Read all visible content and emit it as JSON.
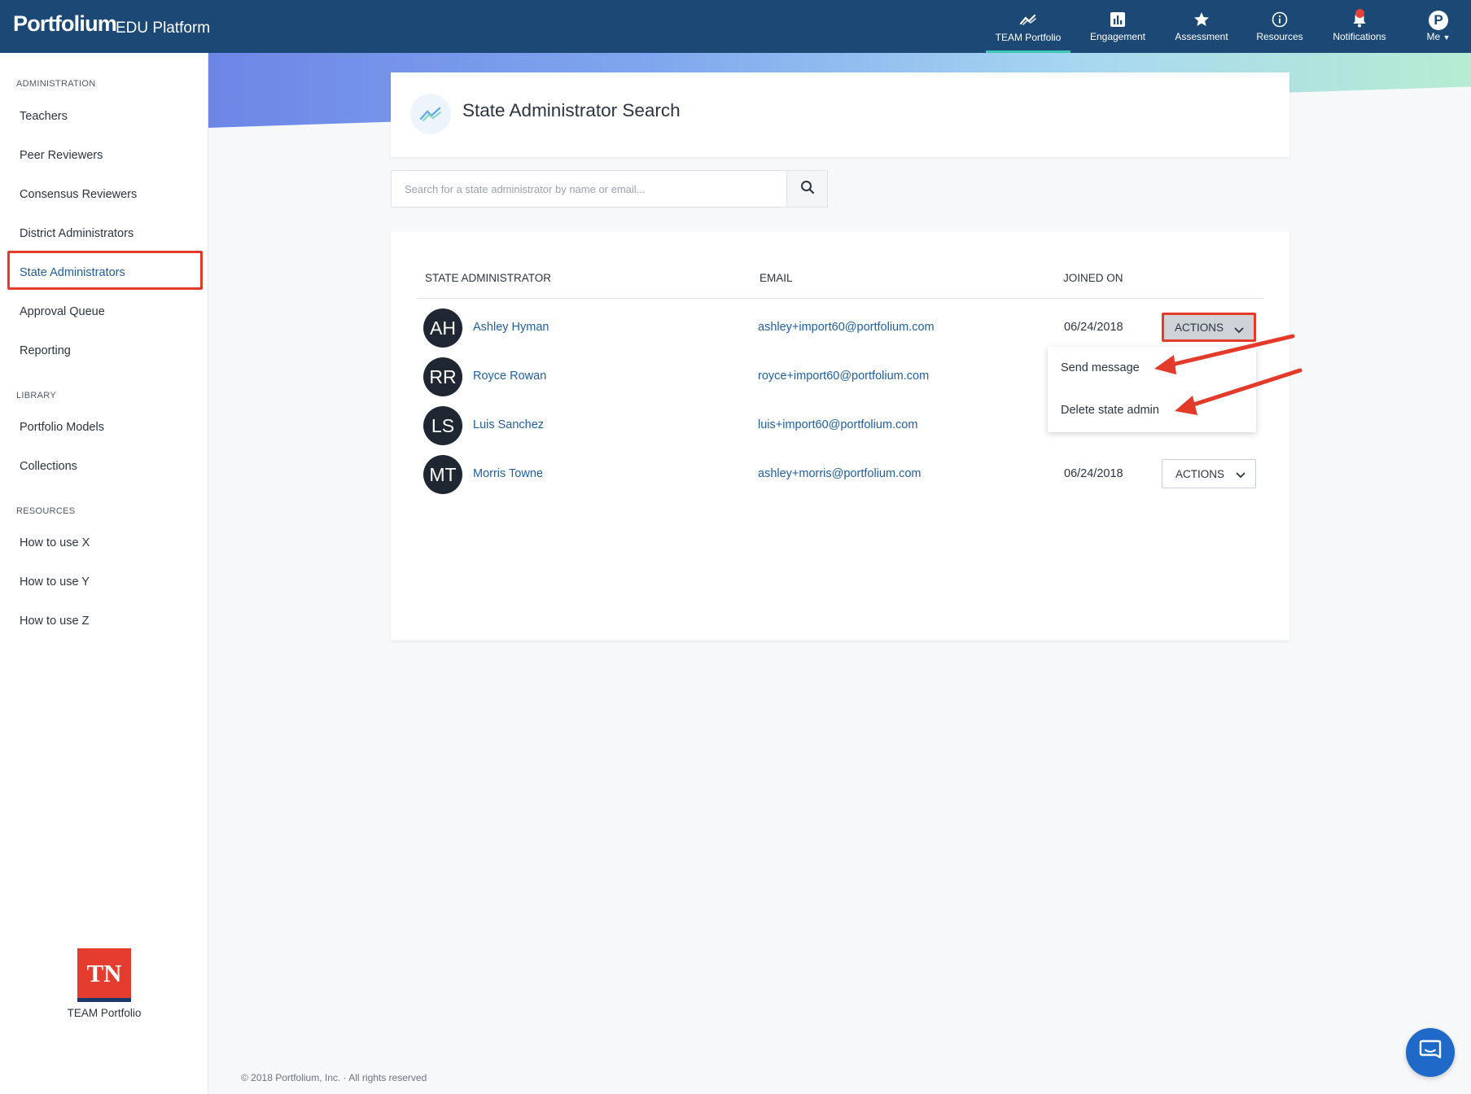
{
  "app": {
    "brand": "Portfolium",
    "subtitle": "EDU Platform"
  },
  "topnav": [
    {
      "label": "TEAM Portfolio",
      "icon": "chart-line-icon",
      "active": true
    },
    {
      "label": "Engagement",
      "icon": "bar-chart-icon"
    },
    {
      "label": "Assessment",
      "icon": "star-icon"
    },
    {
      "label": "Resources",
      "icon": "info-icon"
    },
    {
      "label": "Notifications",
      "icon": "bell-icon"
    },
    {
      "label": "Me",
      "icon": "user-avatar-icon",
      "avatar_letter": "P"
    }
  ],
  "sidebar": {
    "sections": [
      {
        "title": "ADMINISTRATION",
        "items": [
          "Teachers",
          "Peer Reviewers",
          "Consensus Reviewers",
          "District Administrators",
          "State Administrators",
          "Approval Queue",
          "Reporting"
        ]
      },
      {
        "title": "LIBRARY",
        "items": [
          "Portfolio Models",
          "Collections"
        ]
      },
      {
        "title": "RESOURCES",
        "items": [
          "How to use X",
          "How to use Y",
          "How to use Z"
        ]
      }
    ],
    "selected": "State Administrators",
    "badge_text": "TN",
    "badge_label": "TEAM Portfolio"
  },
  "page": {
    "title": "State Administrator Search",
    "search_placeholder": "Search for a state administrator by name or email..."
  },
  "table": {
    "headers": [
      "STATE ADMINISTRATOR",
      "EMAIL",
      "JOINED ON"
    ],
    "rows": [
      {
        "initials": "AH",
        "name": "Ashley Hyman",
        "email": "ashley+import60@portfolium.com",
        "joined": "06/24/2018",
        "action": "ACTIONS"
      },
      {
        "initials": "RR",
        "name": "Royce Rowan",
        "email": "royce+import60@portfolium.com",
        "joined": "",
        "action": ""
      },
      {
        "initials": "LS",
        "name": "Luis Sanchez",
        "email": "luis+import60@portfolium.com",
        "joined": "",
        "action": ""
      },
      {
        "initials": "MT",
        "name": "Morris Towne",
        "email": "ashley+morris@portfolium.com",
        "joined": "06/24/2018",
        "action": "ACTIONS"
      }
    ]
  },
  "dropdown": {
    "items": [
      "Send message",
      "Delete state admin"
    ]
  },
  "footer": "© 2018 Portfolium, Inc. · All rights reserved",
  "colors": {
    "topbar": "#1b4874",
    "link": "#1f5fa0",
    "highlight": "#e33b2a",
    "active_tab": "#3ec7b5"
  }
}
